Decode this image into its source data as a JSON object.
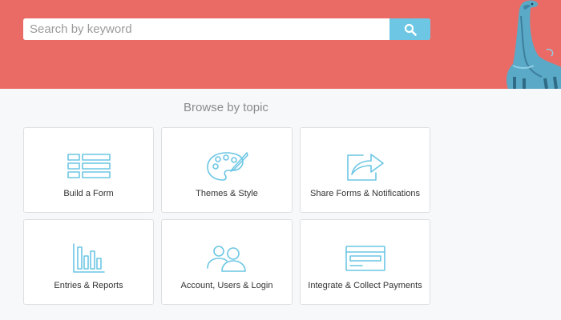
{
  "search": {
    "placeholder": "Search by keyword",
    "value": ""
  },
  "browse": {
    "title": "Browse by topic",
    "topics": [
      {
        "label": "Build a Form",
        "icon": "form-fields-icon"
      },
      {
        "label": "Themes & Style",
        "icon": "palette-icon"
      },
      {
        "label": "Share Forms & Notifications",
        "icon": "share-arrow-icon"
      },
      {
        "label": "Entries & Reports",
        "icon": "bar-chart-icon"
      },
      {
        "label": "Account, Users & Login",
        "icon": "users-icon"
      },
      {
        "label": "Integrate & Collect Payments",
        "icon": "credit-card-icon"
      }
    ]
  },
  "colors": {
    "hero": "#ea6b66",
    "accent": "#6cc6e4",
    "page_bg": "#f7f8fa"
  }
}
